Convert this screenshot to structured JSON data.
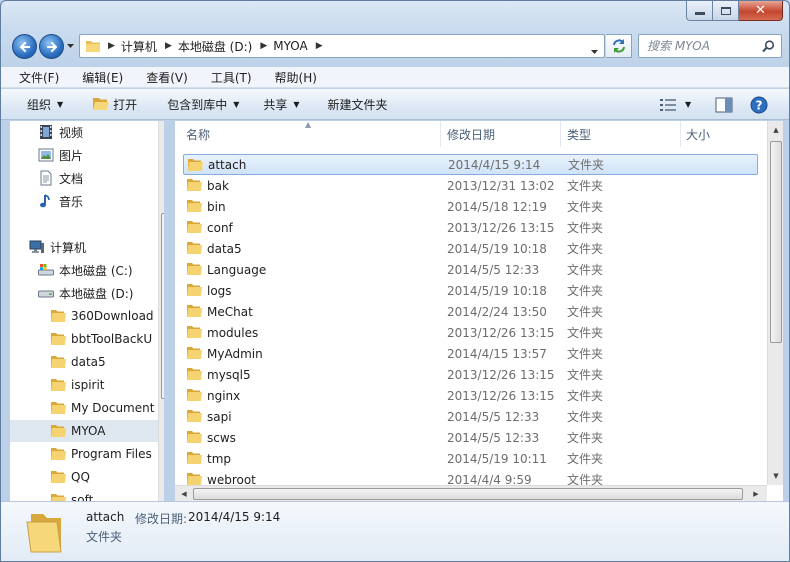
{
  "address": {
    "crumbs": [
      "计算机",
      "本地磁盘 (D:)",
      "MYOA"
    ]
  },
  "search": {
    "placeholder": "搜索 MYOA"
  },
  "menu": [
    "文件(F)",
    "编辑(E)",
    "查看(V)",
    "工具(T)",
    "帮助(H)"
  ],
  "commands": {
    "organize": "组织",
    "open": "打开",
    "include_library": "包含到库中",
    "share": "共享",
    "new_folder": "新建文件夹"
  },
  "nav": {
    "libraries": [
      {
        "label": "视频",
        "icon": "video-library-icon"
      },
      {
        "label": "图片",
        "icon": "picture-library-icon"
      },
      {
        "label": "文档",
        "icon": "document-library-icon"
      },
      {
        "label": "音乐",
        "icon": "music-library-icon"
      }
    ],
    "computer": "计算机",
    "drive_c": "本地磁盘 (C:)",
    "drive_d": "本地磁盘 (D:)",
    "folders": [
      "360Download",
      "bbtToolBackU",
      "data5",
      "ispirit",
      "My Document",
      "MYOA",
      "Program Files",
      "QQ",
      "soft"
    ],
    "selected_folder": "MYOA"
  },
  "columns": {
    "name": "名称",
    "date": "修改日期",
    "type": "类型",
    "size": "大小"
  },
  "files": [
    {
      "name": "attach",
      "date": "2014/4/15 9:14",
      "type": "文件夹"
    },
    {
      "name": "bak",
      "date": "2013/12/31 13:02",
      "type": "文件夹"
    },
    {
      "name": "bin",
      "date": "2014/5/18 12:19",
      "type": "文件夹"
    },
    {
      "name": "conf",
      "date": "2013/12/26 13:15",
      "type": "文件夹"
    },
    {
      "name": "data5",
      "date": "2014/5/19 10:18",
      "type": "文件夹"
    },
    {
      "name": "Language",
      "date": "2014/5/5 12:33",
      "type": "文件夹"
    },
    {
      "name": "logs",
      "date": "2014/5/19 10:18",
      "type": "文件夹"
    },
    {
      "name": "MeChat",
      "date": "2014/2/24 13:50",
      "type": "文件夹"
    },
    {
      "name": "modules",
      "date": "2013/12/26 13:15",
      "type": "文件夹"
    },
    {
      "name": "MyAdmin",
      "date": "2014/4/15 13:57",
      "type": "文件夹"
    },
    {
      "name": "mysql5",
      "date": "2013/12/26 13:15",
      "type": "文件夹"
    },
    {
      "name": "nginx",
      "date": "2013/12/26 13:15",
      "type": "文件夹"
    },
    {
      "name": "sapi",
      "date": "2014/5/5 12:33",
      "type": "文件夹"
    },
    {
      "name": "scws",
      "date": "2014/5/5 12:33",
      "type": "文件夹"
    },
    {
      "name": "tmp",
      "date": "2014/5/19 10:11",
      "type": "文件夹"
    },
    {
      "name": "webroot",
      "date": "2014/4/4 9:59",
      "type": "文件夹"
    }
  ],
  "selected_file": "attach",
  "details": {
    "name": "attach",
    "date_label": "修改日期:",
    "date": "2014/4/15 9:14",
    "type": "文件夹"
  }
}
